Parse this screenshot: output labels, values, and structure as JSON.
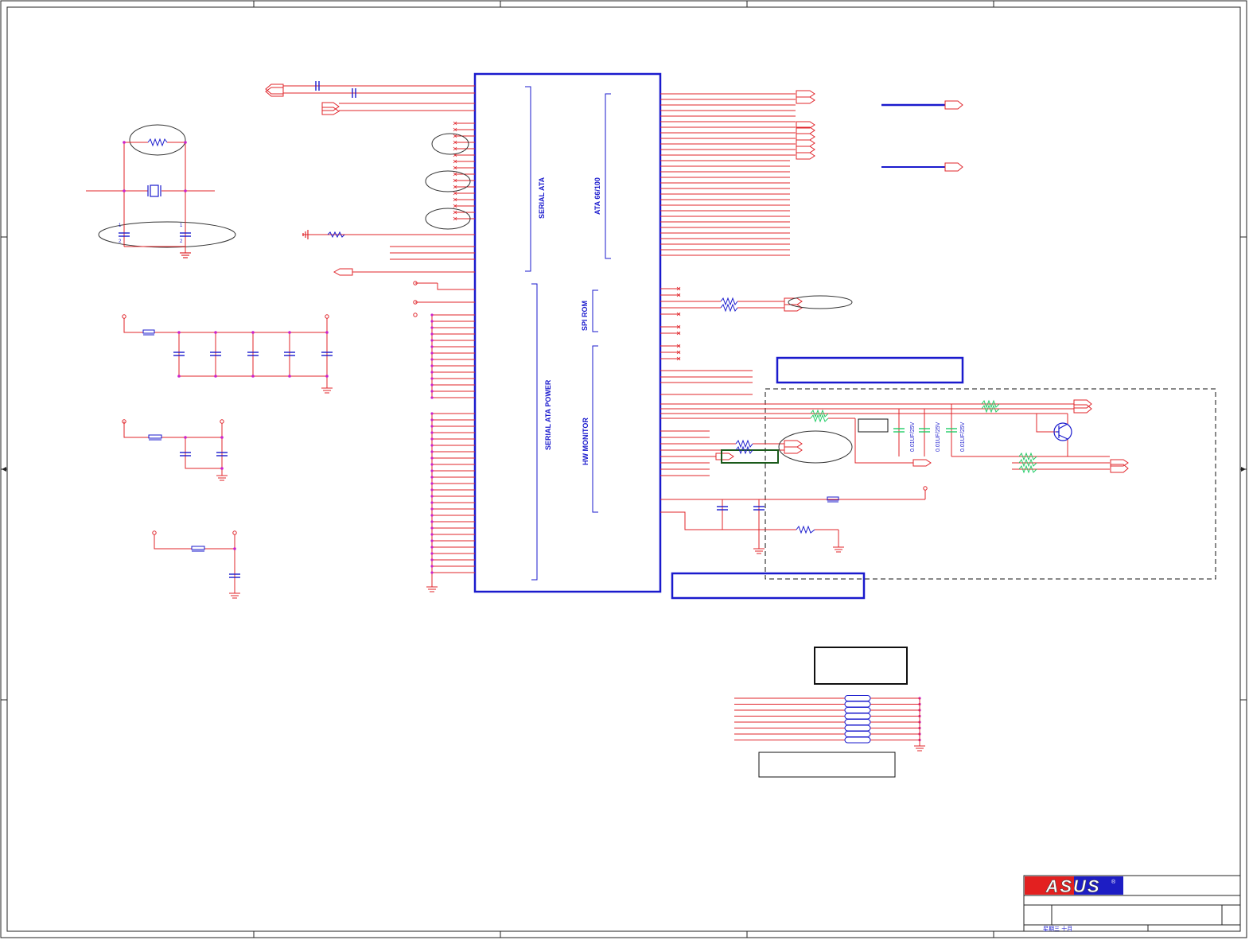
{
  "colors": {
    "wire": "#e0242a",
    "component": "#1a1acd",
    "junction": "#cc22cc",
    "frame": "#222222",
    "highlight": "#22cc66",
    "box_green": "#1a5a1a",
    "logo_red": "#e32020",
    "logo_blue": "#1d1dc4"
  },
  "chip": {
    "block_labels": {
      "serial_ata": "SERIAL ATA",
      "ata": "ATA 66/100",
      "serial_ata_power": "SERIAL ATA POWER",
      "spi_rom": "SPI ROM",
      "hw_monitor": "HW MONITOR"
    }
  },
  "capacitor_value": "0.01UF/25V",
  "capacitor_values": [
    "0.01UF/25V",
    "0.01UF/25V",
    "0.01UF/25V"
  ],
  "pin_numbers": {
    "one": "1",
    "two": "2"
  },
  "title_block": {
    "logo_text": "ASUS",
    "registered_mark": "®",
    "date_text": "星期三 十月"
  }
}
